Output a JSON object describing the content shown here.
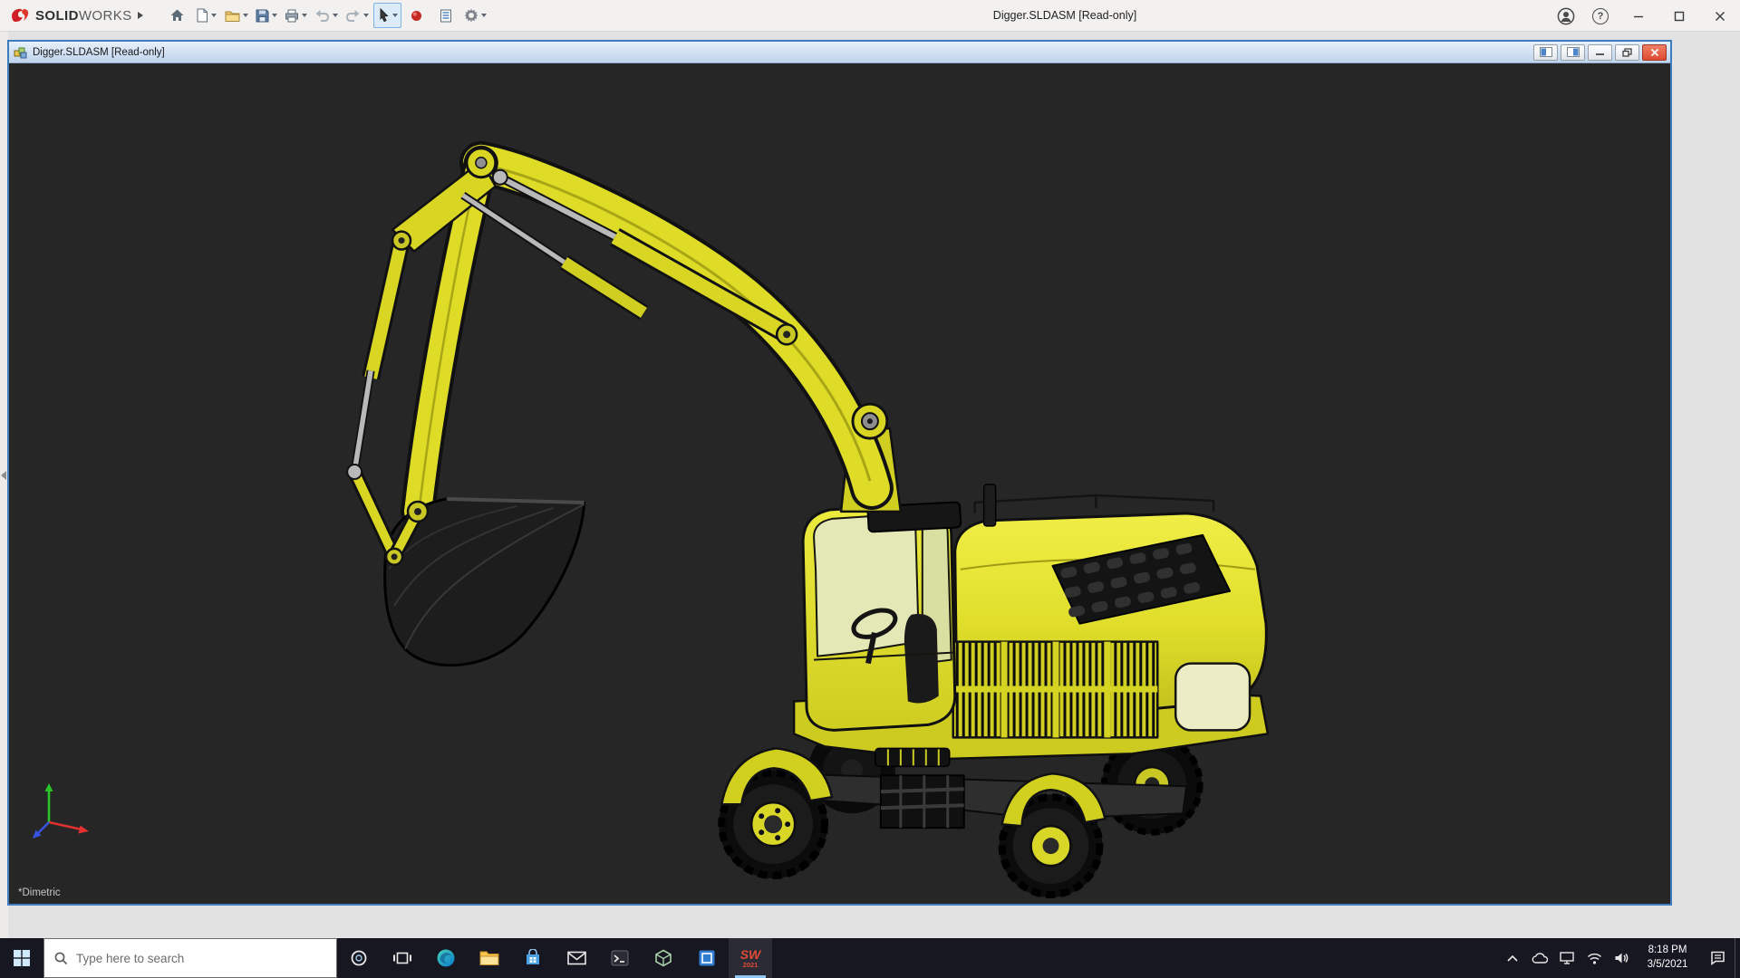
{
  "colors": {
    "accent_blue": "#3e7cc0",
    "viewport_background": "#262626",
    "taskbar_background": "#171721",
    "excavator_yellow": "#dedc26",
    "close_button_red": "#dd4a31"
  },
  "app_titlebar": {
    "logo": {
      "solid": "SOLID",
      "works": "WORKS"
    },
    "title": "Digger.SLDASM [Read-only]",
    "help_glyph": "?",
    "toolbar_icons": [
      "expand-arrow",
      "home",
      "new-document",
      "open",
      "save",
      "print",
      "undo",
      "redo",
      "select",
      "render-red-sphere",
      "design-binder",
      "options-gear"
    ]
  },
  "document_window": {
    "title": "Digger.SLDASM [Read-only]"
  },
  "viewport": {
    "orientation_label": "*Dimetric",
    "model_description": "yellow wheeled excavator, dimetric view"
  },
  "taskbar": {
    "search_placeholder": "Type here to search",
    "app_icons": [
      "start",
      "cortana",
      "task-view",
      "edge",
      "file-explorer",
      "store",
      "mail",
      "terminal",
      "3d-viewer",
      "media-app",
      "solidworks"
    ],
    "solidworks": {
      "label": "SW",
      "year": "2021"
    },
    "tray_icons": [
      "tray-expand",
      "onedrive",
      "display",
      "wifi",
      "volume",
      "notifications",
      "show-desktop"
    ],
    "clock": {
      "time": "8:18 PM",
      "date": "3/5/2021"
    }
  }
}
